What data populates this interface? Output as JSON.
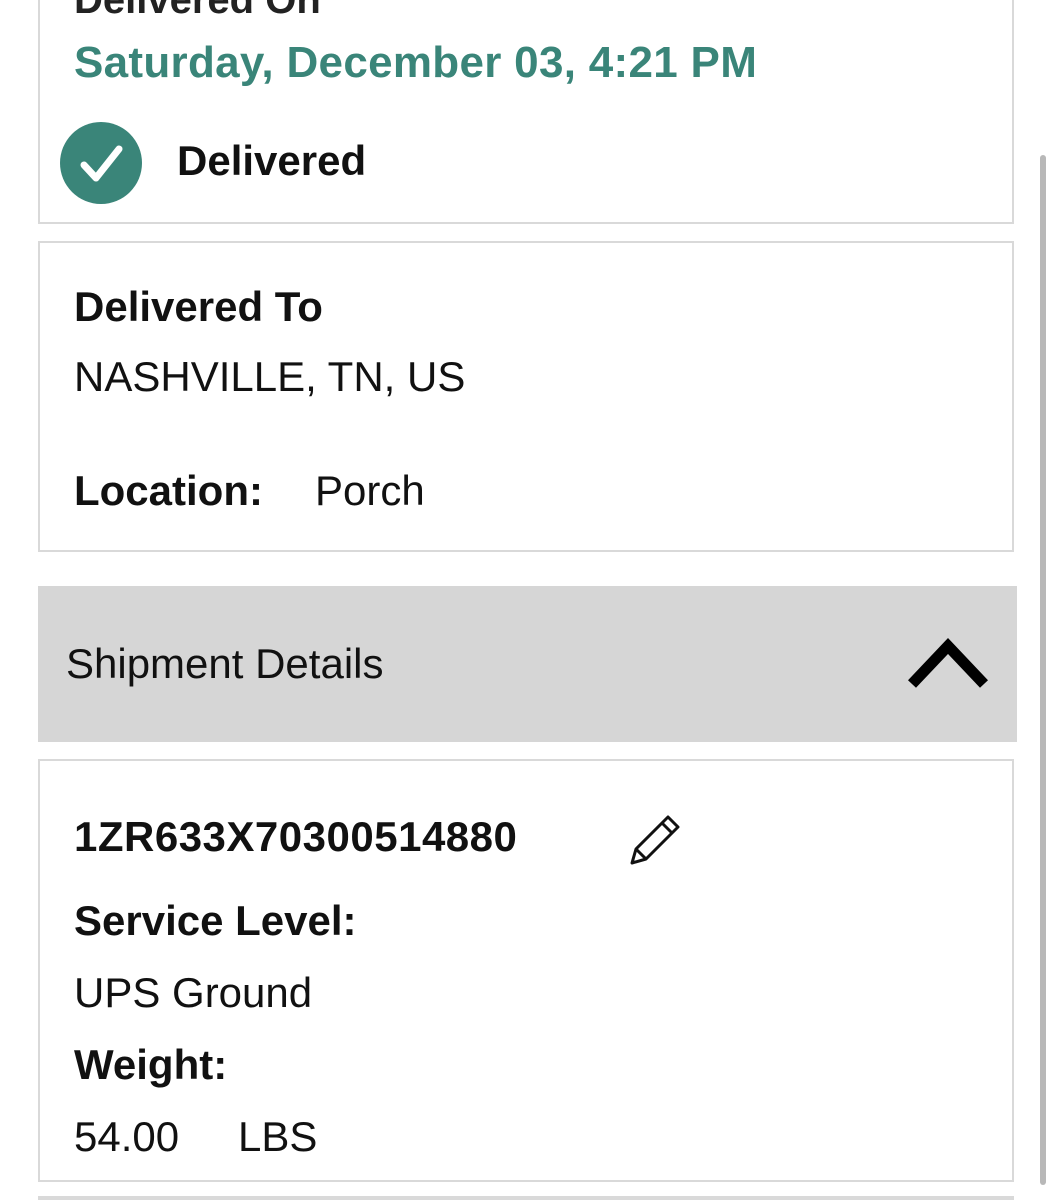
{
  "status": {
    "heading": "Delivered On",
    "date": "Saturday, December 03, 4:21 PM",
    "label": "Delivered",
    "icon": "check-circle-icon",
    "accent_color": "#3a8579"
  },
  "destination": {
    "title": "Delivered To",
    "city": "NASHVILLE, TN, US",
    "location_label": "Location:",
    "location_value": "Porch"
  },
  "shipment_details": {
    "header": "Shipment Details",
    "toggle_icon": "chevron-up-icon",
    "tracking_number": "1ZR633X70300514880",
    "edit_icon": "pencil-icon",
    "service_level_label": "Service Level:",
    "service_level_value": "UPS Ground",
    "weight_label": "Weight:",
    "weight_value": "54.00",
    "weight_unit": "LBS"
  }
}
